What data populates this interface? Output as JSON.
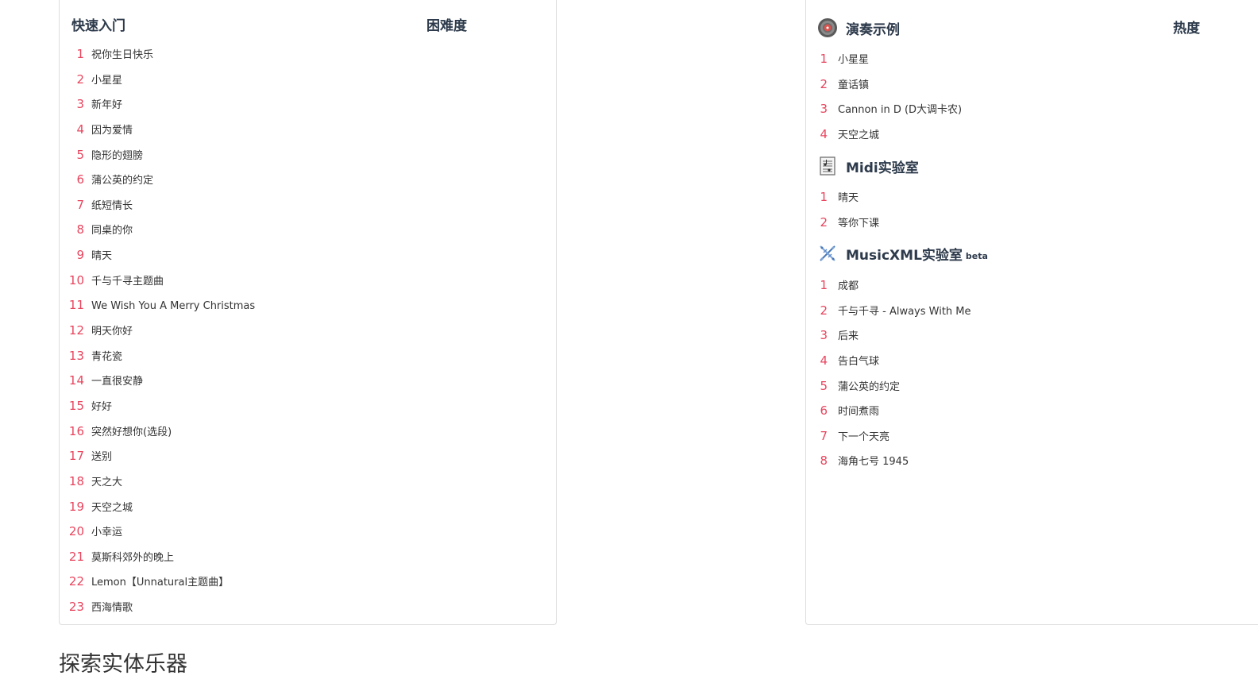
{
  "quickstart": {
    "title": "快速入门",
    "column": "困难度",
    "items": [
      {
        "num": "1",
        "label": "祝你生日快乐"
      },
      {
        "num": "2",
        "label": "小星星"
      },
      {
        "num": "3",
        "label": "新年好"
      },
      {
        "num": "4",
        "label": "因为爱情"
      },
      {
        "num": "5",
        "label": "隐形的翅膀"
      },
      {
        "num": "6",
        "label": "蒲公英的约定"
      },
      {
        "num": "7",
        "label": "纸短情长"
      },
      {
        "num": "8",
        "label": "同桌的你"
      },
      {
        "num": "9",
        "label": "晴天"
      },
      {
        "num": "10",
        "label": "千与千寻主题曲"
      },
      {
        "num": "11",
        "label": "We Wish You A Merry Christmas"
      },
      {
        "num": "12",
        "label": "明天你好"
      },
      {
        "num": "13",
        "label": "青花瓷"
      },
      {
        "num": "14",
        "label": "一直很安静"
      },
      {
        "num": "15",
        "label": "好好"
      },
      {
        "num": "16",
        "label": "突然好想你(选段)"
      },
      {
        "num": "17",
        "label": "送别"
      },
      {
        "num": "18",
        "label": "天之大"
      },
      {
        "num": "19",
        "label": "天空之城"
      },
      {
        "num": "20",
        "label": "小幸运"
      },
      {
        "num": "21",
        "label": "莫斯科郊外的晚上"
      },
      {
        "num": "22",
        "label": "Lemon【Unnatural主题曲】"
      },
      {
        "num": "23",
        "label": "西海情歌"
      }
    ]
  },
  "demo": {
    "title": "演奏示例",
    "column": "热度",
    "icon": "vinyl-record-icon",
    "items": [
      {
        "num": "1",
        "label": "小星星"
      },
      {
        "num": "2",
        "label": "童话镇"
      },
      {
        "num": "3",
        "label": "Cannon in D (D大调卡农)"
      },
      {
        "num": "4",
        "label": "天空之城"
      }
    ]
  },
  "midi": {
    "title": "Midi实验室",
    "icon": "sheet-music-document-icon",
    "items": [
      {
        "num": "1",
        "label": "晴天"
      },
      {
        "num": "2",
        "label": "等你下课"
      }
    ]
  },
  "musicxml": {
    "title": "MusicXML实验室",
    "badge": "beta",
    "icon": "dna-helix-icon",
    "items": [
      {
        "num": "1",
        "label": "成都"
      },
      {
        "num": "2",
        "label": "千与千寻 - Always With Me"
      },
      {
        "num": "3",
        "label": "后来"
      },
      {
        "num": "4",
        "label": "告白气球"
      },
      {
        "num": "5",
        "label": "蒲公英的约定"
      },
      {
        "num": "6",
        "label": "时间煮雨"
      },
      {
        "num": "7",
        "label": "下一个天亮"
      },
      {
        "num": "8",
        "label": "海角七号 1945"
      }
    ]
  },
  "explore": {
    "title": "探索实体乐器"
  },
  "colors": {
    "number": "#e8455e",
    "heading": "#2d3a4b",
    "border": "#dddddd"
  }
}
